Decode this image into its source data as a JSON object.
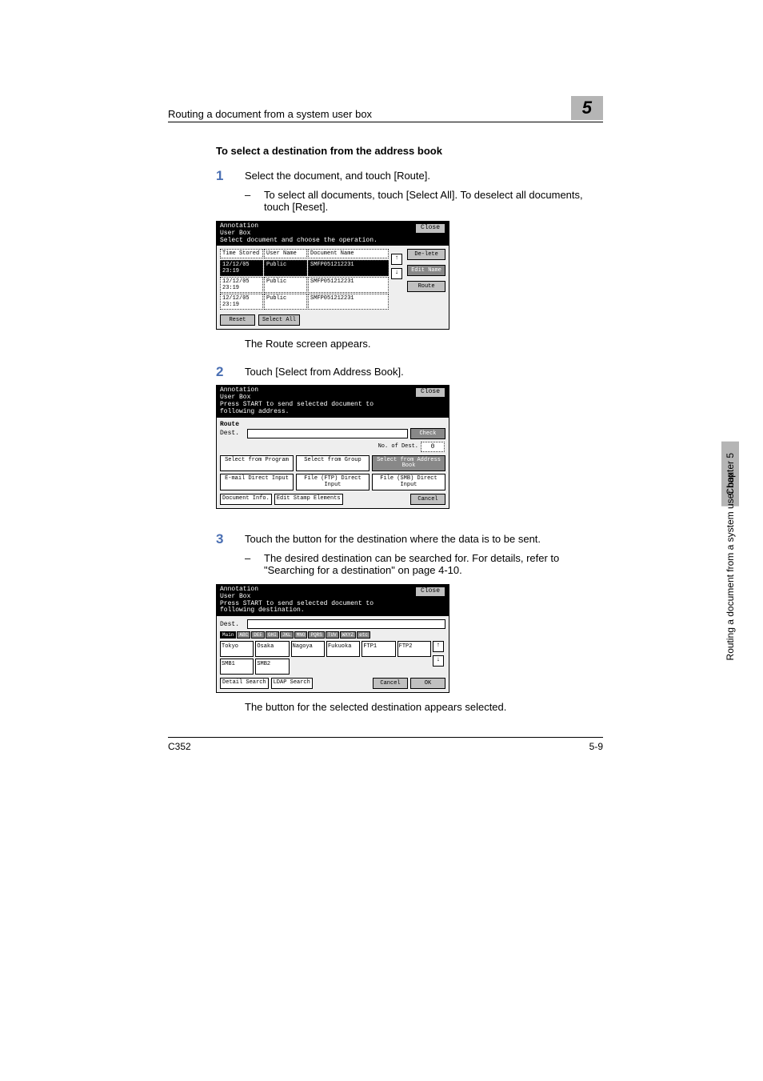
{
  "header": {
    "title": "Routing a document from a system user box",
    "chapter_badge": "5"
  },
  "section_heading": "To select a destination from the address book",
  "step1": {
    "num": "1",
    "text": "Select the document, and touch [Route].",
    "sub": "To select all documents, touch [Select All]. To deselect all documents, touch [Reset]."
  },
  "panel1": {
    "title": "Annotation\nUser Box",
    "subtitle": "Select document and choose the operation.",
    "close": "Close",
    "cols": {
      "time": "Time Stored",
      "user": "User Name",
      "doc": "Document Name"
    },
    "rows": [
      {
        "time": "12/12/05 23:19",
        "user": "Public",
        "doc": "SMFP051212231",
        "selected": true
      },
      {
        "time": "12/12/05 23:19",
        "user": "Public",
        "doc": "SMFP051212231",
        "selected": false
      },
      {
        "time": "12/12/05 23:19",
        "user": "Public",
        "doc": "SMFP051212231",
        "selected": false
      }
    ],
    "side": {
      "delete": "De-lete",
      "edit": "Edit Name",
      "route": "Route"
    },
    "arrows": {
      "up": "↑",
      "down": "↓"
    },
    "bottom": {
      "reset": "Reset",
      "select_all": "Select All"
    }
  },
  "result1": "The Route screen appears.",
  "step2": {
    "num": "2",
    "text": "Touch [Select from Address Book]."
  },
  "panel2": {
    "title": "Annotation\nUser Box",
    "subtitle": "Press START to send selected document to following address.",
    "close": "Close",
    "route_label": "Route",
    "dest_label": "Dest.",
    "check": "Check",
    "nodest_label": "No. of Dest.",
    "nodest_val": "0",
    "buttons": {
      "sel_program": "Select from Program",
      "sel_group": "Select from Group",
      "sel_addr": "Select from Address Book",
      "email": "E-mail Direct Input",
      "ftp": "File (FTP) Direct Input",
      "smb": "File (SMB) Direct Input"
    },
    "bottom": {
      "doc_info": "Document Info.",
      "edit_stamp": "Edit Stamp Elements",
      "cancel": "Cancel"
    }
  },
  "step3": {
    "num": "3",
    "text": "Touch the button for the destination where the data is to be sent.",
    "sub": "The desired destination can be searched for. For details, refer to \"Searching for a destination\" on page 4-10."
  },
  "panel3": {
    "title": "Annotation\nUser Box",
    "subtitle": "Press START to send selected document to following destination.",
    "close": "Close",
    "dest_label": "Dest.",
    "index": [
      "Main",
      "ABC",
      "DEF",
      "GHI",
      "JKL",
      "MNO",
      "PQRS",
      "TUV",
      "WXYZ",
      "etc"
    ],
    "addrs": [
      "Tokyo",
      "Osaka",
      "Nagoya",
      "Fukuoka",
      "FTP1",
      "FTP2",
      "SMB1",
      "SMB2"
    ],
    "arrows": {
      "up": "↑",
      "down": "↓"
    },
    "bottom": {
      "detail": "Detail Search",
      "ldap": "LDAP Search",
      "cancel": "Cancel",
      "ok": "OK"
    }
  },
  "result3": "The button for the selected destination appears selected.",
  "side": {
    "chapter": "Chapter 5",
    "text": "Routing a document from a system user box"
  },
  "footer": {
    "left": "C352",
    "right": "5-9"
  }
}
